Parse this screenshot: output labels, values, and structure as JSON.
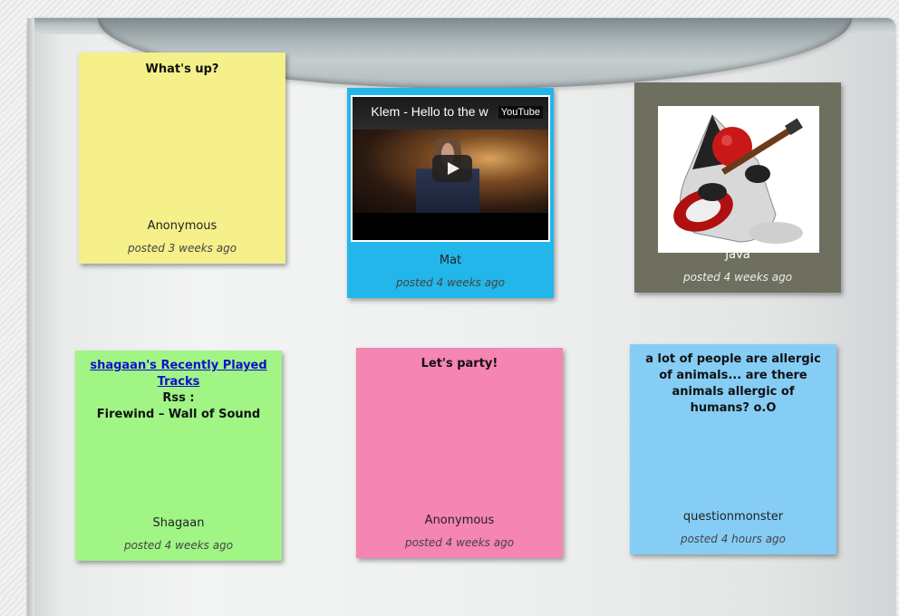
{
  "notes": [
    {
      "title": "What's up?",
      "author": "Anonymous",
      "posted": "posted 3 weeks ago",
      "color": "#f5f08a"
    },
    {
      "video_title": "Klem - Hello to the w",
      "video_brand": "YouTube",
      "author": "Mat",
      "posted": "posted 4 weeks ago",
      "color": "#23b6ea"
    },
    {
      "image": "java-duke-guitar",
      "author": "Java",
      "posted": "posted 4 weeks ago",
      "color": "#6f6f5f"
    },
    {
      "link": "shagaan's Recently Played Tracks",
      "line2": "Rss :",
      "line3": "Firewind – Wall of Sound",
      "author": "Shagaan",
      "posted": "posted 4 weeks ago",
      "color": "#a0f585"
    },
    {
      "title": "Let's party!",
      "author": "Anonymous",
      "posted": "posted 4 weeks ago",
      "color": "#f585b2"
    },
    {
      "title": "a lot of people are allergic of animals... are there animals allergic of humans? o.O",
      "author": "questionmonster",
      "posted": "posted 4 hours ago",
      "color": "#85cdf5"
    }
  ]
}
